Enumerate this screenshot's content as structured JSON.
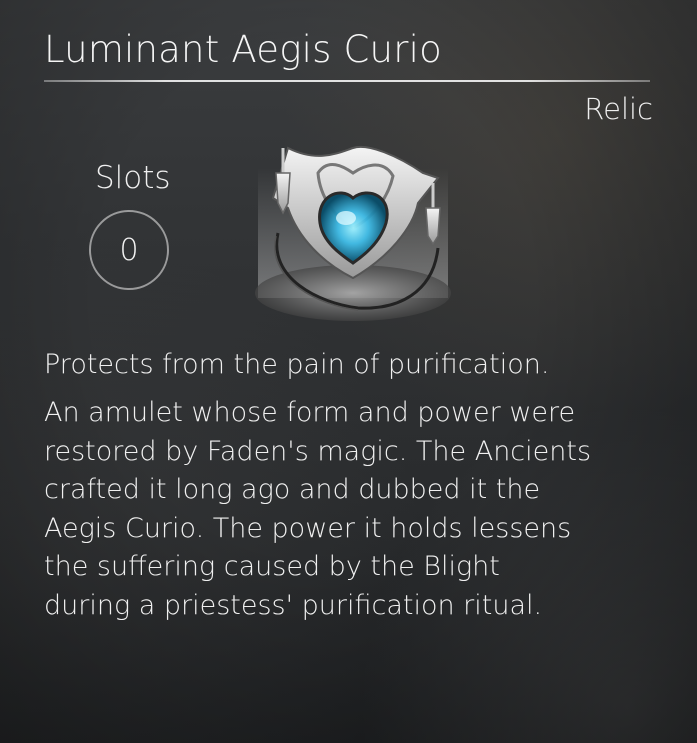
{
  "item": {
    "name": "Luminant Aegis Curio",
    "category": "Relic",
    "slots_label": "Slots",
    "slots_value": "0",
    "short_description": "Protects from the pain of purification.",
    "long_description_lines": [
      "An amulet whose form and power were",
      "restored by Faden's magic. The Ancients",
      "crafted it long ago and dubbed it the",
      "Aegis Curio. The power it holds lessens",
      "the suffering caused by the Blight",
      "during a priestess' purification ritual."
    ],
    "icon": "amulet-icon"
  },
  "colors": {
    "text": "#f2f2f2",
    "gem": "#35b9e6",
    "background": "#323436"
  }
}
